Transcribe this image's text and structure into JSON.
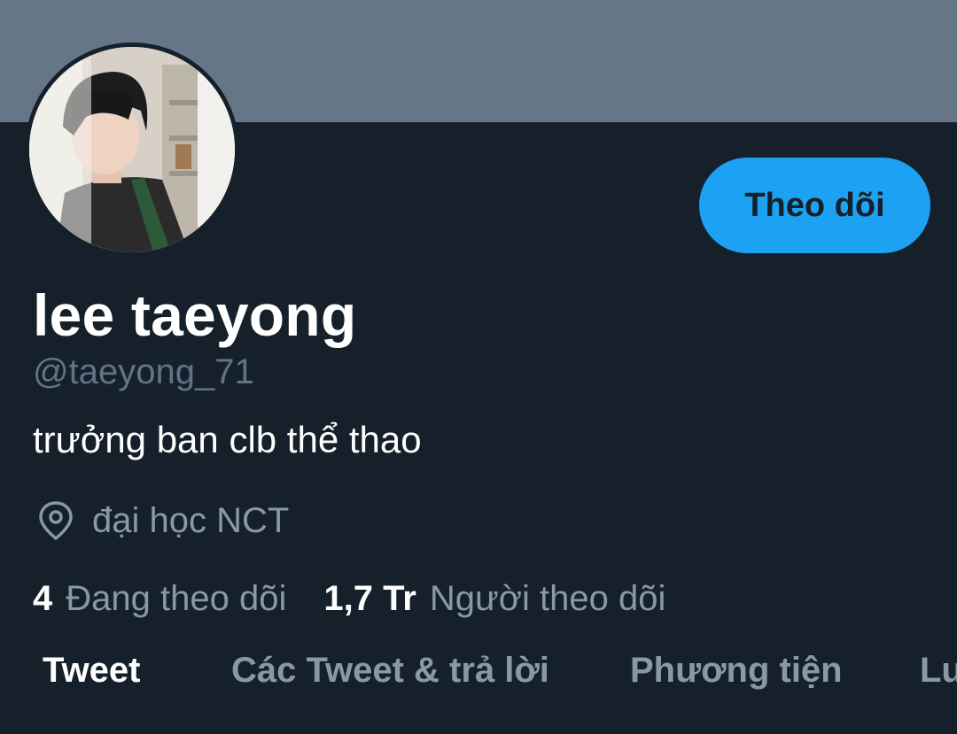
{
  "profile": {
    "display_name": "lee taeyong",
    "handle": "@taeyong_71",
    "bio": "trưởng ban clb thể thao",
    "location": "đại học NCT",
    "follow_label": "Theo dõi"
  },
  "stats": {
    "following_count": "4",
    "following_label": "Đang theo dõi",
    "followers_count": "1,7 Tr",
    "followers_label": "Người theo dõi"
  },
  "tabs": [
    {
      "label": "Tweet",
      "active": true
    },
    {
      "label": "Các Tweet & trả lời",
      "active": false
    },
    {
      "label": "Phương tiện",
      "active": false
    },
    {
      "label": "Lượt thích",
      "active": false
    }
  ],
  "colors": {
    "background": "#15202b",
    "banner": "#657786",
    "accent": "#1da1f2",
    "muted_text": "#8899a6"
  },
  "icons": {
    "location": "location-pin-icon"
  }
}
